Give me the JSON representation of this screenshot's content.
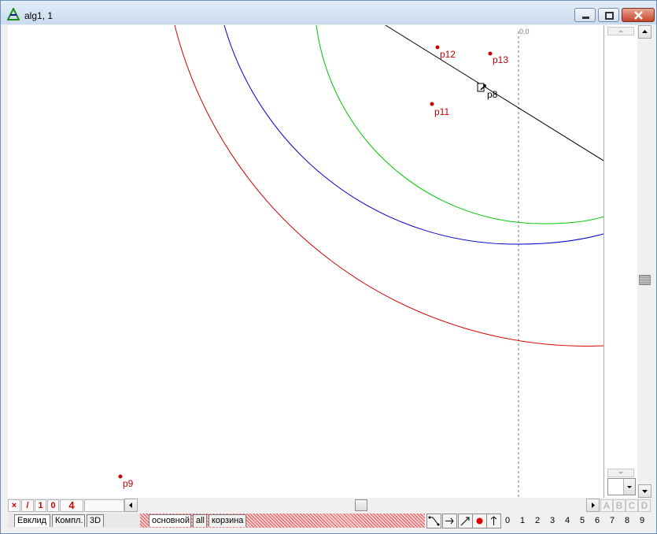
{
  "window": {
    "title": "alg1, 1"
  },
  "canvas": {
    "axis_label": "0.0",
    "points": [
      {
        "name": "p12",
        "label": "p12"
      },
      {
        "name": "p13",
        "label": "p13"
      },
      {
        "name": "p11",
        "label": "p11"
      },
      {
        "name": "p8",
        "label": "p8"
      },
      {
        "name": "p9",
        "label": "p9"
      }
    ],
    "colors": {
      "red": "#d40000",
      "blue": "#0000c8",
      "green": "#00c800",
      "line": "#000000",
      "point": "#d40000"
    }
  },
  "toolbar": {
    "small_buttons": [
      "×",
      "/",
      "1",
      "0"
    ],
    "counter": "4"
  },
  "tabs": {
    "left": [
      "Евклид",
      "Компл.",
      "3D"
    ],
    "layers": [
      "основной",
      "all",
      "корзина"
    ]
  },
  "letters": [
    "A",
    "B",
    "C",
    "D"
  ],
  "digits": [
    "0",
    "1",
    "2",
    "3",
    "4",
    "5",
    "6",
    "7",
    "8",
    "9"
  ],
  "icons": {
    "app": "geometry-app-icon",
    "tools": [
      "segment-tool-icon",
      "arrow-right-icon",
      "diagonal-arrow-icon",
      "red-dot-icon",
      "arrow-up-icon"
    ]
  }
}
